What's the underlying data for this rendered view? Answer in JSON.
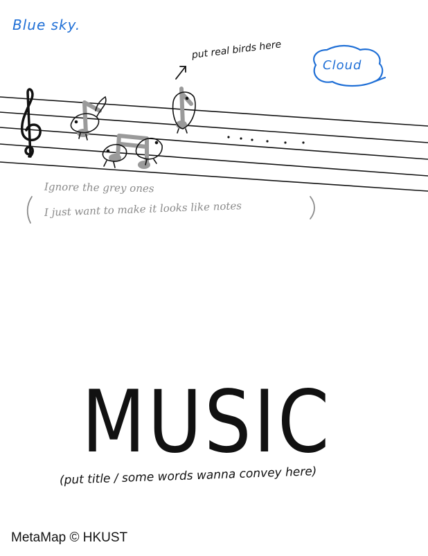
{
  "annotations": {
    "sky": "Blue sky.",
    "birds": "put real birds here",
    "cloud": "Cloud",
    "grey_line_1": "Ignore the grey ones",
    "grey_line_2": "I just want to make it looks like notes"
  },
  "title": "MUSIC",
  "subtitle": "(put title / some words wanna convey here)",
  "footer": "MetaMap © HKUST",
  "colors": {
    "annotation_blue": "#1f6fd6",
    "ink": "#111111",
    "grey_notes": "#8a8a8a"
  },
  "icons": [
    "treble-clef-icon",
    "bird-note-icon",
    "arrow-icon",
    "cloud-outline-icon"
  ]
}
